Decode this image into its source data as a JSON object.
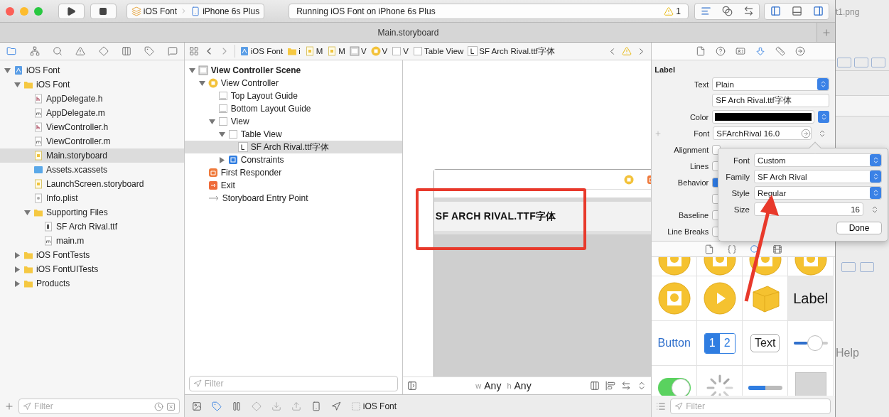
{
  "window": {
    "title": "Main.storyboard",
    "scheme": "iOS Font",
    "device": "iPhone 6s Plus",
    "status": "Running iOS Font on iPhone 6s Plus",
    "warning_count": "1"
  },
  "navigator": {
    "tree": [
      {
        "label": "iOS Font",
        "kind": "project",
        "expanded": true,
        "selected": false,
        "children": [
          {
            "label": "iOS Font",
            "kind": "folder",
            "expanded": true,
            "selected": false,
            "children": [
              {
                "label": "AppDelegate.h",
                "kind": "header",
                "selected": false
              },
              {
                "label": "AppDelegate.m",
                "kind": "source",
                "selected": false
              },
              {
                "label": "ViewController.h",
                "kind": "header",
                "selected": false
              },
              {
                "label": "ViewController.m",
                "kind": "source",
                "selected": false
              },
              {
                "label": "Main.storyboard",
                "kind": "storyboard",
                "selected": true
              },
              {
                "label": "Assets.xcassets",
                "kind": "assets",
                "selected": false
              },
              {
                "label": "LaunchScreen.storyboard",
                "kind": "storyboard",
                "selected": false
              },
              {
                "label": "Info.plist",
                "kind": "plist",
                "selected": false
              },
              {
                "label": "Supporting Files",
                "kind": "folder",
                "expanded": true,
                "selected": false,
                "children": [
                  {
                    "label": "SF Arch Rival.ttf",
                    "kind": "font",
                    "selected": false
                  },
                  {
                    "label": "main.m",
                    "kind": "source",
                    "selected": false
                  }
                ]
              }
            ]
          },
          {
            "label": "iOS FontTests",
            "kind": "folder",
            "expanded": false,
            "selected": false
          },
          {
            "label": "iOS FontUITests",
            "kind": "folder",
            "expanded": false,
            "selected": false
          },
          {
            "label": "Products",
            "kind": "folder",
            "expanded": false,
            "selected": false
          }
        ]
      }
    ],
    "filter_placeholder": "Filter"
  },
  "jump_bar": [
    {
      "label": "iOS Font",
      "kind": "project"
    },
    {
      "label": "i",
      "kind": "folder"
    },
    {
      "label": "M",
      "kind": "storyboard"
    },
    {
      "label": "M",
      "kind": "storyboard"
    },
    {
      "label": "V",
      "kind": "scene"
    },
    {
      "label": "V",
      "kind": "controller"
    },
    {
      "label": "V",
      "kind": "view"
    },
    {
      "label": "Table View",
      "kind": "view"
    },
    {
      "label": "SF Arch Rival.ttf字体",
      "kind": "label"
    }
  ],
  "outline": {
    "tree": [
      {
        "label": "View Controller Scene",
        "kind": "scene",
        "expanded": true,
        "selected": false,
        "children": [
          {
            "label": "View Controller",
            "kind": "controller",
            "expanded": true,
            "selected": false,
            "children": [
              {
                "label": "Top Layout Guide",
                "kind": "guide",
                "selected": false
              },
              {
                "label": "Bottom Layout Guide",
                "kind": "guide",
                "selected": false
              },
              {
                "label": "View",
                "kind": "view",
                "expanded": true,
                "selected": false,
                "children": [
                  {
                    "label": "Table View",
                    "kind": "view",
                    "expanded": true,
                    "selected": false,
                    "children": [
                      {
                        "label": "SF Arch Rival.ttf字体",
                        "kind": "label",
                        "selected": true
                      }
                    ]
                  },
                  {
                    "label": "Constraints",
                    "kind": "constraints",
                    "expanded": false,
                    "selected": false
                  }
                ]
              }
            ]
          },
          {
            "label": "First Responder",
            "kind": "responder",
            "selected": false
          },
          {
            "label": "Exit",
            "kind": "exit",
            "selected": false
          },
          {
            "label": "Storyboard Entry Point",
            "kind": "entry",
            "selected": false
          }
        ]
      }
    ],
    "filter_placeholder": "Filter"
  },
  "canvas": {
    "label_text": "SF ARCH RIVAL.TTF字体",
    "size_class": [
      {
        "prefix": "w",
        "value": "Any"
      },
      {
        "prefix": "h",
        "value": "Any"
      }
    ]
  },
  "inspector": {
    "section": "Label",
    "rows": [
      {
        "label": "Text",
        "kind": "popup",
        "value": "Plain"
      },
      {
        "kind": "text",
        "value": "SF Arch Rival.ttf字体"
      },
      {
        "label": "Color",
        "kind": "color"
      },
      {
        "label": "Font",
        "kind": "font",
        "value": "SFArchRival 16.0"
      },
      {
        "label": "Alignment",
        "kind": "covered"
      },
      {
        "label": "Lines",
        "kind": "covered"
      },
      {
        "label": "Behavior",
        "kind": "checkbox",
        "checked": true
      },
      {
        "kind": "checkbox",
        "checked": false
      },
      {
        "label": "Baseline",
        "kind": "covered"
      },
      {
        "label": "Line Breaks",
        "kind": "covered"
      }
    ]
  },
  "font_popover": {
    "rows": [
      {
        "label": "Font",
        "kind": "popup",
        "value": "Custom"
      },
      {
        "label": "Family",
        "kind": "popup",
        "value": "SF Arch Rival"
      },
      {
        "label": "Style",
        "kind": "popup",
        "value": "Regular"
      },
      {
        "label": "Size",
        "kind": "stepper",
        "value": "16"
      }
    ],
    "done": "Done"
  },
  "library": {
    "items": [
      {
        "kind": "circle",
        "selected": false
      },
      {
        "kind": "circle",
        "selected": false
      },
      {
        "kind": "circle",
        "selected": false
      },
      {
        "kind": "circle",
        "selected": false
      },
      {
        "kind": "circle",
        "selected": false
      },
      {
        "kind": "media",
        "selected": false
      },
      {
        "kind": "cube",
        "selected": false
      },
      {
        "kind": "label",
        "text": "Label",
        "selected": true
      },
      {
        "kind": "button",
        "text": "Button",
        "selected": false
      },
      {
        "kind": "segmented",
        "selected": false,
        "segments": [
          {
            "text": "1",
            "selected": true
          },
          {
            "text": "2",
            "selected": false
          }
        ]
      },
      {
        "kind": "textfield",
        "text": "Text",
        "selected": false
      },
      {
        "kind": "slider",
        "level": 0.4,
        "selected": false
      },
      {
        "kind": "switch",
        "on": true,
        "selected": false
      },
      {
        "kind": "spinner",
        "selected": false
      },
      {
        "kind": "progress",
        "level": 0.5,
        "selected": false
      },
      {
        "kind": "view",
        "selected": false
      }
    ],
    "filter_placeholder": "Filter"
  },
  "debug_bar": {
    "target": "iOS Font"
  },
  "annotations": {
    "highlight_box": true,
    "pointer_arrow": true
  },
  "background_window": {
    "title": "t1.png",
    "menu": "Help"
  }
}
